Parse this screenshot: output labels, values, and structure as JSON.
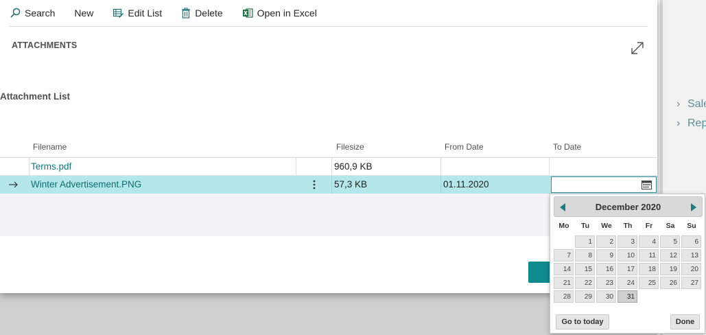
{
  "toolbar": {
    "search": "Search",
    "new": "New",
    "edit_list": "Edit List",
    "delete": "Delete",
    "open_in_excel": "Open in Excel"
  },
  "section_title": "ATTACHMENTS",
  "list_title": "Attachment List",
  "columns": {
    "filename": "Filename",
    "filesize": "Filesize",
    "from_date": "From Date",
    "to_date": "To Date"
  },
  "rows": [
    {
      "filename": "Terms.pdf",
      "filesize": "960,9 KB",
      "from_date": "",
      "to_date": ""
    },
    {
      "filename": "Winter Advertisement.PNG",
      "filesize": "57,3 KB",
      "from_date": "01.11.2020",
      "to_date": ""
    }
  ],
  "background_links": [
    "Sale",
    "Rep"
  ],
  "datepicker": {
    "month_title": "December 2020",
    "weekdays": [
      "Mo",
      "Tu",
      "We",
      "Th",
      "Fr",
      "Sa",
      "Su"
    ],
    "weeks": [
      [
        "",
        "1",
        "2",
        "3",
        "4",
        "5",
        "6"
      ],
      [
        "7",
        "8",
        "9",
        "10",
        "11",
        "12",
        "13"
      ],
      [
        "14",
        "15",
        "16",
        "17",
        "18",
        "19",
        "20"
      ],
      [
        "21",
        "22",
        "23",
        "24",
        "25",
        "26",
        "27"
      ],
      [
        "28",
        "29",
        "30",
        "31",
        "",
        "",
        ""
      ]
    ],
    "selected_day": "31",
    "go_to_today": "Go to today",
    "done": "Done"
  },
  "colors": {
    "accent": "#0f8b8d",
    "selected_row": "#b4e6ea",
    "link_text": "#0b7c83"
  },
  "icons": [
    "search-icon",
    "edit-list-icon",
    "delete-icon",
    "excel-icon",
    "expand-icon",
    "calendar-icon",
    "row-arrow-icon",
    "more-options-icon"
  ]
}
